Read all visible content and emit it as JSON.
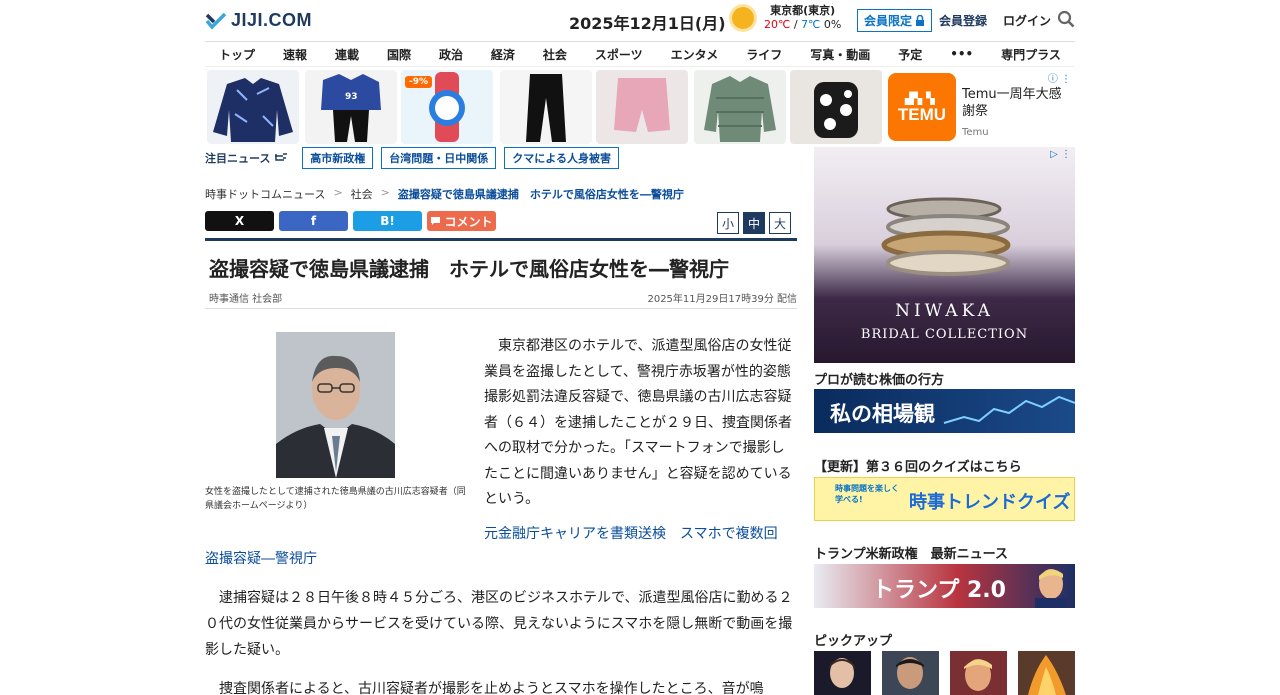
{
  "header": {
    "logo_text": "JIJI.COM",
    "date": "2025年12月1日(月)",
    "weather": {
      "city": "東京都(東京)",
      "high": "20℃",
      "sep": " / ",
      "low": "7℃",
      "precip": "0%"
    },
    "member_only": "会員限定",
    "register": "会員登録",
    "login": "ログイン"
  },
  "nav": [
    "トップ",
    "速報",
    "連載",
    "国際",
    "政治",
    "経済",
    "社会",
    "スポーツ",
    "エンタメ",
    "ライフ",
    "写真・動画",
    "予定",
    "•••",
    "専門プラス"
  ],
  "top_ad": {
    "temu_logo_top": "▟▚▝▖",
    "temu_logo": "TEMU",
    "text": "Temu一周年大感謝祭",
    "brand": "Temu",
    "discount": "-9%",
    "jersey_number": "93",
    "adchoice": "ⓘ ⋮"
  },
  "hot": {
    "label": "注目ニュース",
    "tags": [
      "高市新政権",
      "台湾問題・日中関係",
      "クマによる人身被害"
    ]
  },
  "breadcrumb": {
    "home": "時事ドットコムニュース",
    "sep": ">",
    "section": "社会",
    "current": "盗撮容疑で徳島県議逮捕　ホテルで風俗店女性を―警視庁"
  },
  "share": {
    "x": "X",
    "facebook": "f",
    "hatena": "B!",
    "comment": "コメント"
  },
  "font_sizes": [
    "小",
    "中",
    "大"
  ],
  "article": {
    "title": "盗撮容疑で徳島県議逮捕　ホテルで風俗店女性を―警視庁",
    "source": "時事通信 社会部",
    "published": "2025年11月29日17時39分 配信",
    "photo_caption": "女性を盗撮したとして逮捕された徳島県議の古川広志容疑者（同県議会ホームページより）",
    "p1": "東京都港区のホテルで、派遣型風俗店の女性従業員を盗撮したとして、警視庁赤坂署が性的姿態撮影処罰法違反容疑で、徳島県議の古川広志容疑者（６４）を逮捕したことが２９日、捜査関係者への取材で分かった。「スマートフォンで撮影したことに間違いありません」と容疑を認めているという。",
    "related_link_a": "元金融庁キャリアを書類送検　スマホで複数回",
    "related_link_b": "盗撮容疑―警視庁",
    "p2": "逮捕容疑は２８日午後８時４５分ごろ、港区のビジネスホテルで、派遣型風俗店に勤める２０代の女性従業員からサービスを受けている際、見えないようにスマホを隠し無断で動画を撮影した疑い。",
    "p3": "捜査関係者によると、古川容疑者が撮影を止めようとスマホを操作したところ、音が鳴"
  },
  "sidebar": {
    "ad_brand": "NIWAKA",
    "ad_sub": "BRIDAL COLLECTION",
    "ad_choice": "▷ ⋮",
    "stock_head": "プロが読む株価の行方",
    "stock_banner": "私の相場観",
    "quiz_head": "【更新】第３６回のクイズはこちら",
    "quiz_banner_small": "時事問題を楽しく学べる!",
    "quiz_banner": "時事トレンドクイズ",
    "trump_head": "トランプ米新政権　最新ニュース",
    "trump_banner": "トランプ 2.0",
    "pickup_head": "ピックアップ"
  },
  "colors": {
    "brand_navy": "#1f3a5f",
    "link_blue": "#0a4d9a",
    "temp_high": "#e60012",
    "temp_low": "#0a73c6",
    "temu_orange": "#fb7701"
  },
  "icons": {
    "logo": "jiji-logo-icon",
    "weather": "sun-icon",
    "lock": "lock-icon",
    "search": "search-icon",
    "hand": "pointing-hand-icon",
    "comment": "comment-icon"
  }
}
